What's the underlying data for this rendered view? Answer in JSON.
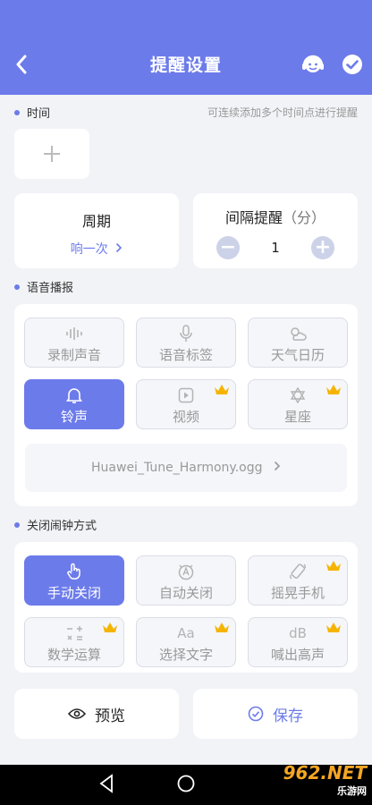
{
  "header": {
    "title": "提醒设置"
  },
  "time": {
    "label": "时间",
    "hint": "可连续添加多个时间点进行提醒"
  },
  "period": {
    "title": "周期",
    "value": "响一次"
  },
  "interval": {
    "title": "间隔提醒",
    "unit": "（分）",
    "value": "1"
  },
  "voice": {
    "label": "语音播报",
    "options": [
      "录制声音",
      "语音标签",
      "天气日历",
      "铃声",
      "视频",
      "星座"
    ],
    "file": "Huawei_Tune_Harmony.ogg"
  },
  "close": {
    "label": "关闭闹钟方式",
    "options": [
      "手动关闭",
      "自动关闭",
      "摇晃手机",
      "数学运算",
      "选择文字",
      "喊出高声"
    ],
    "icon_text": {
      "text_select": "Aa",
      "shout": "dB"
    }
  },
  "actions": {
    "preview": "预览",
    "save": "保存"
  },
  "watermark": {
    "brand": "962.NET",
    "sub": "乐游网"
  },
  "colors": {
    "accent": "#6c7bea",
    "crown": "#f5b400"
  }
}
